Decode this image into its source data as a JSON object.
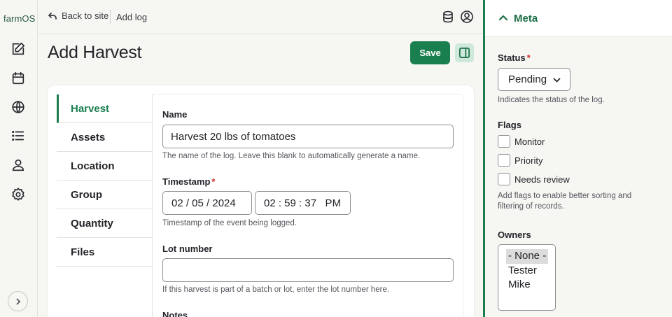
{
  "app": {
    "brand": "farmOS"
  },
  "rail": {
    "items": [
      {
        "icon": "edit-icon"
      },
      {
        "icon": "calendar-icon"
      },
      {
        "icon": "globe-icon"
      },
      {
        "icon": "list-icon"
      },
      {
        "icon": "user-icon"
      },
      {
        "icon": "gear-icon"
      }
    ],
    "expand_icon": "chevron-right-icon"
  },
  "topbar": {
    "back_label": "Back to site",
    "breadcrumb": "Add log"
  },
  "page": {
    "title": "Add Harvest",
    "save_label": "Save"
  },
  "tabs": [
    "Harvest",
    "Assets",
    "Location",
    "Group",
    "Quantity",
    "Files"
  ],
  "form": {
    "name_label": "Name",
    "name_value": "Harvest 20 lbs of tomatoes",
    "name_help": "The name of the log. Leave this blank to automatically generate a name.",
    "timestamp_label": "Timestamp",
    "required_mark": "*",
    "date_value": "02 / 05 / 2024",
    "time_value": "02 : 59 : 37   PM",
    "timestamp_help": "Timestamp of the event being logged.",
    "lot_label": "Lot number",
    "lot_value": "",
    "lot_help": "If this harvest is part of a batch or lot, enter the lot number here.",
    "notes_label": "Notes"
  },
  "meta": {
    "title": "Meta",
    "status_label": "Status",
    "status_value": "Pending",
    "status_help": "Indicates the status of the log.",
    "flags_label": "Flags",
    "flags": [
      "Monitor",
      "Priority",
      "Needs review"
    ],
    "flags_help_1": "Add flags to enable better sorting and",
    "flags_help_2": "filtering of records.",
    "owners_label": "Owners",
    "owners": [
      "- None -",
      "Tester",
      "Mike"
    ],
    "owners_selected": "- None -"
  },
  "colors": {
    "accent": "#1a7f4f",
    "required": "#d12f2f",
    "background": "#f6f6f3"
  }
}
